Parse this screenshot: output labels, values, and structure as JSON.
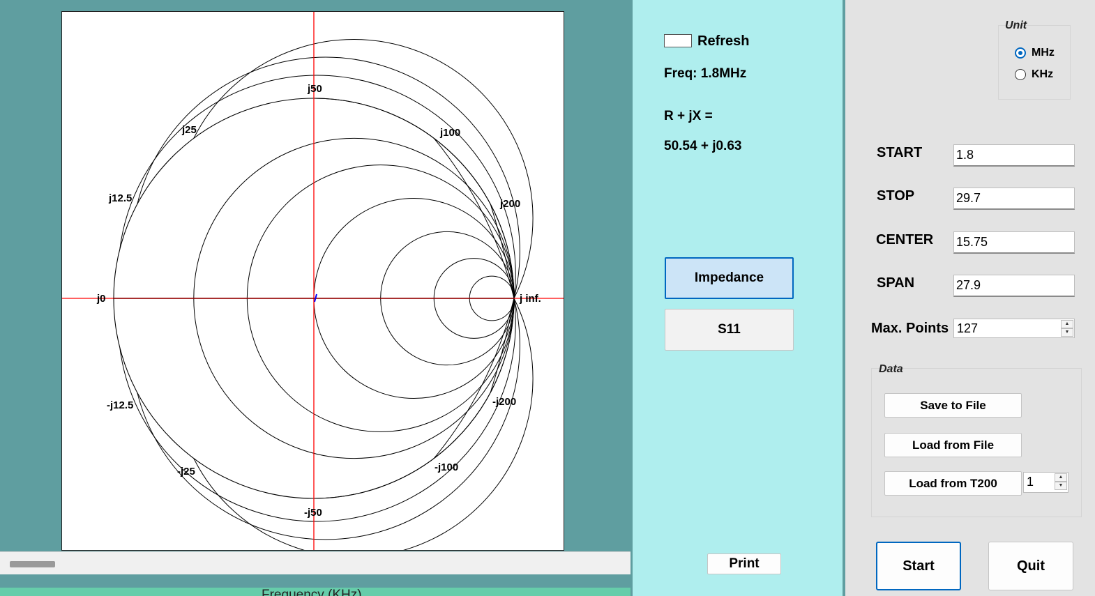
{
  "smith_chart": {
    "reactance_labels": {
      "j0": "j0",
      "j_inf": "j inf.",
      "j50": "j50",
      "j100": "j100",
      "j200": "j200",
      "j25": "j25",
      "j12_5": "j12.5",
      "neg_j12_5": "-j12.5",
      "neg_j25": "-j25",
      "neg_j50": "-j50",
      "neg_j100": "-j100",
      "neg_j200": "-j200"
    },
    "resistance_circles_ohms": [
      12.5,
      25,
      50,
      100,
      200,
      400
    ],
    "reactance_arcs_ohms": [
      12.5,
      25,
      50,
      100,
      200,
      400
    ],
    "reference_impedance_ohms": 50,
    "cursor_color": "#ff0000",
    "grid_color": "#000000"
  },
  "scrollbar": {
    "thumb": ""
  },
  "frequency_axis": {
    "label": "Frequency (KHz)"
  },
  "refresh": {
    "label": "Refresh"
  },
  "readout": {
    "freq": "Freq:  1.8MHz",
    "rjx_label": "R + jX =",
    "rjx_value": "50.54 + j0.63"
  },
  "buttons": {
    "impedance": "Impedance",
    "s11": "S11",
    "print": "Print",
    "start": "Start",
    "quit": "Quit"
  },
  "unit": {
    "title": "Unit",
    "options": [
      "MHz",
      "KHz"
    ],
    "selected": "MHz"
  },
  "sweep": {
    "start_label": "START",
    "start_value": "1.8",
    "stop_label": "STOP",
    "stop_value": "29.7",
    "center_label": "CENTER",
    "center_value": "15.75",
    "span_label": "SPAN",
    "span_value": "27.9",
    "max_points_label": "Max. Points",
    "max_points_value": "127"
  },
  "data": {
    "title": "Data",
    "save": "Save to File",
    "load_file": "Load from File",
    "load_t200": "Load from T200",
    "t200_channel": "1"
  },
  "colors": {
    "left_bg": "#5f9ea0",
    "mid_bg": "#afeeee",
    "right_bg": "#e3e3e3",
    "accent": "#0067c0",
    "freq_strip": "#66cdaa"
  }
}
